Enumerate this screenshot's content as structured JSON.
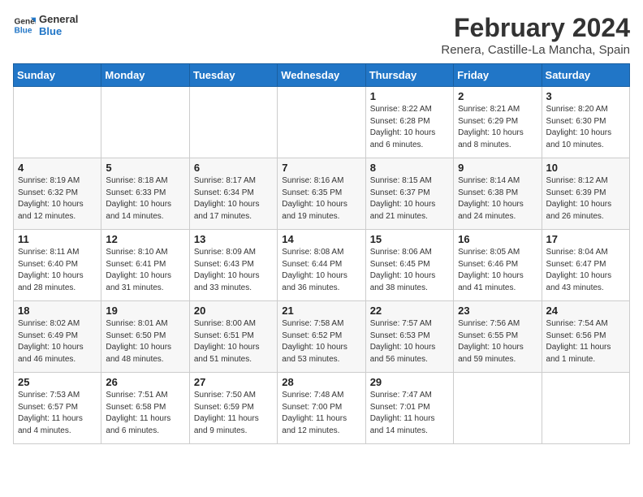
{
  "logo": {
    "line1": "General",
    "line2": "Blue"
  },
  "title": "February 2024",
  "subtitle": "Renera, Castille-La Mancha, Spain",
  "headers": [
    "Sunday",
    "Monday",
    "Tuesday",
    "Wednesday",
    "Thursday",
    "Friday",
    "Saturday"
  ],
  "weeks": [
    [
      {
        "day": "",
        "info": ""
      },
      {
        "day": "",
        "info": ""
      },
      {
        "day": "",
        "info": ""
      },
      {
        "day": "",
        "info": ""
      },
      {
        "day": "1",
        "info": "Sunrise: 8:22 AM\nSunset: 6:28 PM\nDaylight: 10 hours\nand 6 minutes."
      },
      {
        "day": "2",
        "info": "Sunrise: 8:21 AM\nSunset: 6:29 PM\nDaylight: 10 hours\nand 8 minutes."
      },
      {
        "day": "3",
        "info": "Sunrise: 8:20 AM\nSunset: 6:30 PM\nDaylight: 10 hours\nand 10 minutes."
      }
    ],
    [
      {
        "day": "4",
        "info": "Sunrise: 8:19 AM\nSunset: 6:32 PM\nDaylight: 10 hours\nand 12 minutes."
      },
      {
        "day": "5",
        "info": "Sunrise: 8:18 AM\nSunset: 6:33 PM\nDaylight: 10 hours\nand 14 minutes."
      },
      {
        "day": "6",
        "info": "Sunrise: 8:17 AM\nSunset: 6:34 PM\nDaylight: 10 hours\nand 17 minutes."
      },
      {
        "day": "7",
        "info": "Sunrise: 8:16 AM\nSunset: 6:35 PM\nDaylight: 10 hours\nand 19 minutes."
      },
      {
        "day": "8",
        "info": "Sunrise: 8:15 AM\nSunset: 6:37 PM\nDaylight: 10 hours\nand 21 minutes."
      },
      {
        "day": "9",
        "info": "Sunrise: 8:14 AM\nSunset: 6:38 PM\nDaylight: 10 hours\nand 24 minutes."
      },
      {
        "day": "10",
        "info": "Sunrise: 8:12 AM\nSunset: 6:39 PM\nDaylight: 10 hours\nand 26 minutes."
      }
    ],
    [
      {
        "day": "11",
        "info": "Sunrise: 8:11 AM\nSunset: 6:40 PM\nDaylight: 10 hours\nand 28 minutes."
      },
      {
        "day": "12",
        "info": "Sunrise: 8:10 AM\nSunset: 6:41 PM\nDaylight: 10 hours\nand 31 minutes."
      },
      {
        "day": "13",
        "info": "Sunrise: 8:09 AM\nSunset: 6:43 PM\nDaylight: 10 hours\nand 33 minutes."
      },
      {
        "day": "14",
        "info": "Sunrise: 8:08 AM\nSunset: 6:44 PM\nDaylight: 10 hours\nand 36 minutes."
      },
      {
        "day": "15",
        "info": "Sunrise: 8:06 AM\nSunset: 6:45 PM\nDaylight: 10 hours\nand 38 minutes."
      },
      {
        "day": "16",
        "info": "Sunrise: 8:05 AM\nSunset: 6:46 PM\nDaylight: 10 hours\nand 41 minutes."
      },
      {
        "day": "17",
        "info": "Sunrise: 8:04 AM\nSunset: 6:47 PM\nDaylight: 10 hours\nand 43 minutes."
      }
    ],
    [
      {
        "day": "18",
        "info": "Sunrise: 8:02 AM\nSunset: 6:49 PM\nDaylight: 10 hours\nand 46 minutes."
      },
      {
        "day": "19",
        "info": "Sunrise: 8:01 AM\nSunset: 6:50 PM\nDaylight: 10 hours\nand 48 minutes."
      },
      {
        "day": "20",
        "info": "Sunrise: 8:00 AM\nSunset: 6:51 PM\nDaylight: 10 hours\nand 51 minutes."
      },
      {
        "day": "21",
        "info": "Sunrise: 7:58 AM\nSunset: 6:52 PM\nDaylight: 10 hours\nand 53 minutes."
      },
      {
        "day": "22",
        "info": "Sunrise: 7:57 AM\nSunset: 6:53 PM\nDaylight: 10 hours\nand 56 minutes."
      },
      {
        "day": "23",
        "info": "Sunrise: 7:56 AM\nSunset: 6:55 PM\nDaylight: 10 hours\nand 59 minutes."
      },
      {
        "day": "24",
        "info": "Sunrise: 7:54 AM\nSunset: 6:56 PM\nDaylight: 11 hours\nand 1 minute."
      }
    ],
    [
      {
        "day": "25",
        "info": "Sunrise: 7:53 AM\nSunset: 6:57 PM\nDaylight: 11 hours\nand 4 minutes."
      },
      {
        "day": "26",
        "info": "Sunrise: 7:51 AM\nSunset: 6:58 PM\nDaylight: 11 hours\nand 6 minutes."
      },
      {
        "day": "27",
        "info": "Sunrise: 7:50 AM\nSunset: 6:59 PM\nDaylight: 11 hours\nand 9 minutes."
      },
      {
        "day": "28",
        "info": "Sunrise: 7:48 AM\nSunset: 7:00 PM\nDaylight: 11 hours\nand 12 minutes."
      },
      {
        "day": "29",
        "info": "Sunrise: 7:47 AM\nSunset: 7:01 PM\nDaylight: 11 hours\nand 14 minutes."
      },
      {
        "day": "",
        "info": ""
      },
      {
        "day": "",
        "info": ""
      }
    ]
  ]
}
